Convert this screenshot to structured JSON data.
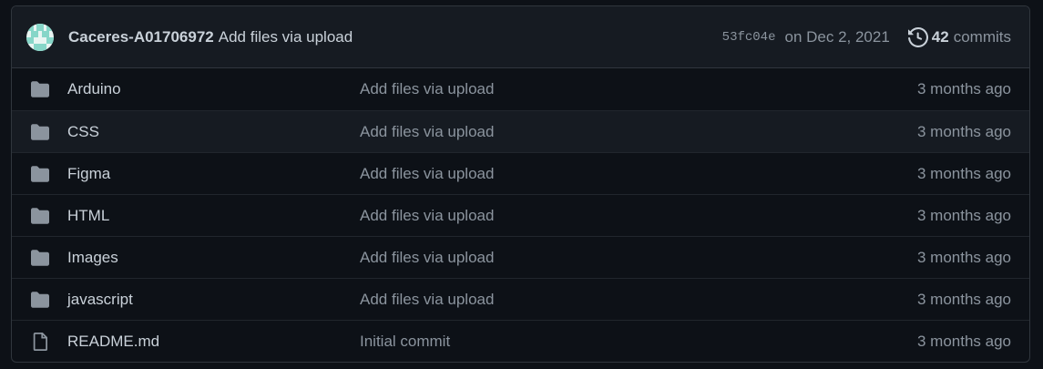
{
  "latest_commit": {
    "author": "Caceres-A01706972",
    "message": "Add files via upload",
    "sha": "53fc04e",
    "date": "on Dec 2, 2021",
    "commit_count": "42",
    "commits_label": "commits",
    "avatar_icon": "identicon-avatar",
    "history_icon": "history-icon"
  },
  "files": [
    {
      "name": "Arduino",
      "type": "folder",
      "icon": "folder-icon",
      "message": "Add files via upload",
      "age": "3 months ago"
    },
    {
      "name": "CSS",
      "type": "folder",
      "icon": "folder-icon",
      "message": "Add files via upload",
      "age": "3 months ago"
    },
    {
      "name": "Figma",
      "type": "folder",
      "icon": "folder-icon",
      "message": "Add files via upload",
      "age": "3 months ago"
    },
    {
      "name": "HTML",
      "type": "folder",
      "icon": "folder-icon",
      "message": "Add files via upload",
      "age": "3 months ago"
    },
    {
      "name": "Images",
      "type": "folder",
      "icon": "folder-icon",
      "message": "Add files via upload",
      "age": "3 months ago"
    },
    {
      "name": "javascript",
      "type": "folder",
      "icon": "folder-icon",
      "message": "Add files via upload",
      "age": "3 months ago"
    },
    {
      "name": "README.md",
      "type": "file",
      "icon": "file-icon",
      "message": "Initial commit",
      "age": "3 months ago"
    }
  ],
  "colors": {
    "background": "#0d1117",
    "header_bg": "#161b22",
    "border": "#30363d",
    "text": "#c9d1d9",
    "muted": "#8b949e",
    "icon": "#8b949e",
    "avatar_teal": "#86d6c8"
  }
}
